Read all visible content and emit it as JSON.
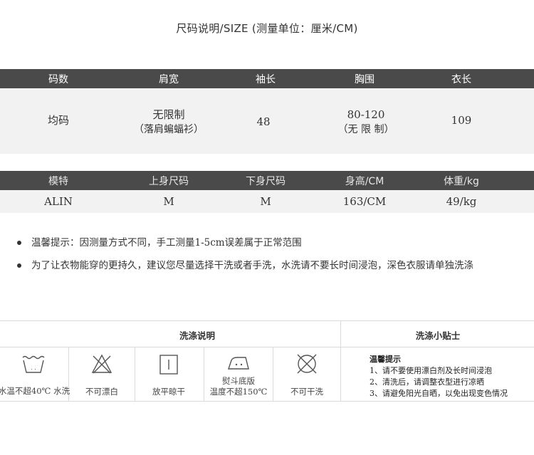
{
  "title": "尺码说明/SIZE (测量单位：厘米/CM)",
  "size_table": {
    "headers": [
      "码数",
      "肩宽",
      "袖长",
      "胸围",
      "衣长"
    ],
    "row": {
      "size": "均码",
      "shoulder_line1": "无限制",
      "shoulder_line2": "（落肩蝙蝠衫）",
      "sleeve": "48",
      "chest_line1": "80-120",
      "chest_line2": "（无 限 制）",
      "length": "109"
    }
  },
  "model_table": {
    "headers": [
      "模特",
      "上身尺码",
      "下身尺码",
      "身高/CM",
      "体重/kg"
    ],
    "row": [
      "ALIN",
      "M",
      "M",
      "163/CM",
      "49/kg"
    ]
  },
  "notes": [
    "温馨提示：因测量方式不同，手工测量1-5cm误差属于正常范围",
    "为了让衣物能穿的更持久，建议您尽量选择干洗或者手洗，水洗请不要长时间浸泡，深色衣服请单独洗涤"
  ],
  "wash": {
    "header_left": "洗涤说明",
    "header_right": "洗涤小贴士",
    "items": [
      {
        "icon": "wash-tub-icon",
        "label": "水温不超40℃ 水洗"
      },
      {
        "icon": "no-bleach-icon",
        "label": "不可漂白"
      },
      {
        "icon": "flat-dry-icon",
        "label": "放平晾干"
      },
      {
        "icon": "iron-icon",
        "label_line1": "熨斗底版",
        "label_line2": "温度不超150℃"
      },
      {
        "icon": "no-dry-clean-icon",
        "label": "不可干洗"
      }
    ],
    "tips": {
      "title": "温馨提示",
      "lines": [
        "1、请不要使用漂白剂及长时间浸泡",
        "2、清洗后，请调整衣型进行凉晒",
        "3、请避免阳光自晒，以免出现变色情况"
      ]
    }
  }
}
